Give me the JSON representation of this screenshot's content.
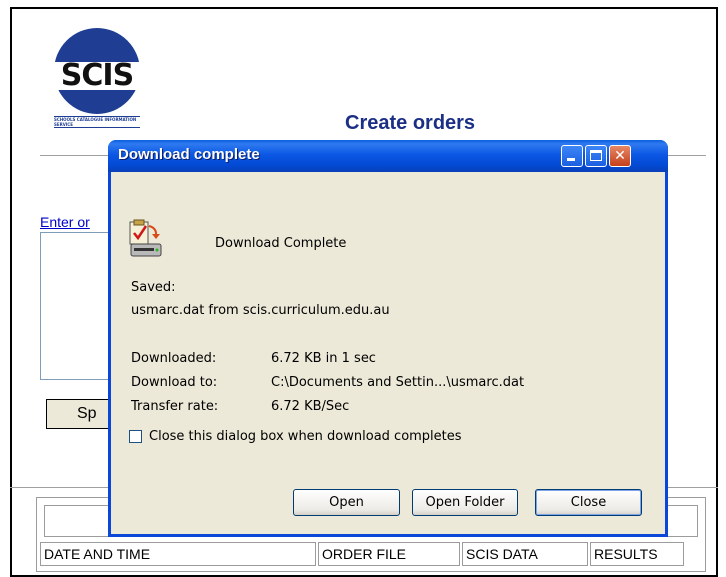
{
  "page": {
    "logo_text": "SCIS",
    "logo_subtext": "SCHOOLS CATALOGUE INFORMATION SERVICE",
    "title": "Create orders",
    "enter_link": "Enter or",
    "button_stub": "Sp",
    "table_headers": [
      "DATE AND TIME",
      "ORDER FILE",
      "SCIS DATA",
      "RESULTS"
    ]
  },
  "dialog": {
    "title": "Download complete",
    "heading": "Download Complete",
    "saved_label": "Saved:",
    "saved_value": "usmarc.dat from scis.curriculum.edu.au",
    "details": [
      {
        "label": "Downloaded:",
        "value": "6.72 KB in 1 sec"
      },
      {
        "label": "Download to:",
        "value": "C:\\Documents and Settin...\\usmarc.dat"
      },
      {
        "label": "Transfer rate:",
        "value": "6.72 KB/Sec"
      }
    ],
    "checkbox_label": "Close this dialog box when download completes",
    "checkbox_checked": false,
    "buttons": {
      "open": "Open",
      "open_folder": "Open Folder",
      "close": "Close"
    },
    "title_buttons": {
      "minimize": "minimize-icon",
      "maximize": "maximize-icon",
      "close": "close-icon"
    }
  },
  "colors": {
    "title_blue": "#1c2f86",
    "link": "#0000cc",
    "dialog_border": "#0a46d8",
    "dialog_bg": "#ece9d8"
  }
}
